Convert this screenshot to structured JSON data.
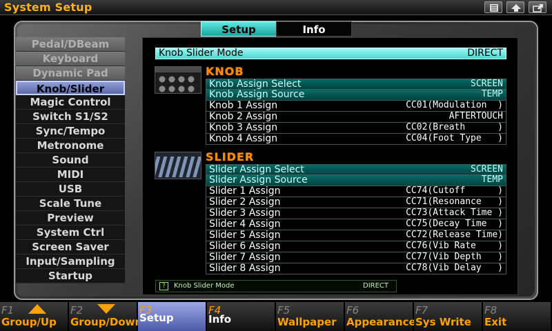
{
  "title": "System Setup",
  "title_buttons": [
    "list-icon",
    "up-arrow-icon",
    "export-icon"
  ],
  "tabs": [
    {
      "label": "Setup",
      "active": true
    },
    {
      "label": "Info",
      "active": false
    }
  ],
  "sidebar": {
    "items": [
      {
        "label": "Pedal/DBeam",
        "state": "dim"
      },
      {
        "label": "Keyboard",
        "state": "dim"
      },
      {
        "label": "Dynamic Pad",
        "state": "dim"
      },
      {
        "label": "Knob/Slider",
        "state": "active"
      },
      {
        "label": "Magic Control",
        "state": "normal"
      },
      {
        "label": "Switch S1/S2",
        "state": "normal"
      },
      {
        "label": "Sync/Tempo",
        "state": "normal"
      },
      {
        "label": "Metronome",
        "state": "normal"
      },
      {
        "label": "Sound",
        "state": "normal"
      },
      {
        "label": "MIDI",
        "state": "normal"
      },
      {
        "label": "USB",
        "state": "normal"
      },
      {
        "label": "Scale Tune",
        "state": "normal"
      },
      {
        "label": "Preview",
        "state": "normal"
      },
      {
        "label": "System Ctrl",
        "state": "normal"
      },
      {
        "label": "Screen Saver",
        "state": "normal"
      },
      {
        "label": "Input/Sampling",
        "state": "normal"
      },
      {
        "label": "Startup",
        "state": "normal"
      }
    ]
  },
  "mode": {
    "label": "Knob Slider Mode",
    "value": "DIRECT"
  },
  "knob": {
    "title": "KNOB",
    "rows": [
      {
        "label": "Knob Assign Select",
        "value": "SCREEN",
        "hl": true
      },
      {
        "label": "Knob Assign Source",
        "value": "TEMP",
        "hl": true
      },
      {
        "label": "Knob 1 Assign",
        "value": "CC01(Modulation  )",
        "hl": false
      },
      {
        "label": "Knob 2 Assign",
        "value": "AFTERTOUCH",
        "hl": false
      },
      {
        "label": "Knob 3 Assign",
        "value": "CC02(Breath      )",
        "hl": false
      },
      {
        "label": "Knob 4 Assign",
        "value": "CC04(Foot Type   )",
        "hl": false
      }
    ]
  },
  "slider": {
    "title": "SLIDER",
    "rows": [
      {
        "label": "Slider Assign Select",
        "value": "SCREEN",
        "hl": true
      },
      {
        "label": "Slider Assign Source",
        "value": "TEMP",
        "hl": true
      },
      {
        "label": "Slider 1 Assign",
        "value": "CC74(Cutoff      )",
        "hl": false
      },
      {
        "label": "Slider 2 Assign",
        "value": "CC71(Resonance   )",
        "hl": false
      },
      {
        "label": "Slider 3 Assign",
        "value": "CC73(Attack Time )",
        "hl": false
      },
      {
        "label": "Slider 4 Assign",
        "value": "CC75(Decay Time  )",
        "hl": false
      },
      {
        "label": "Slider 5 Assign",
        "value": "CC72(Release Time)",
        "hl": false
      },
      {
        "label": "Slider 6 Assign",
        "value": "CC76(Vib Rate    )",
        "hl": false
      },
      {
        "label": "Slider 7 Assign",
        "value": "CC77(Vib Depth   )",
        "hl": false
      },
      {
        "label": "Slider 8 Assign",
        "value": "CC78(Vib Delay   )",
        "hl": false
      }
    ]
  },
  "help": {
    "icon": "?",
    "label": "Knob Slider Mode",
    "value": "DIRECT"
  },
  "fkeys": [
    {
      "num": "F1",
      "label": "Group/Up",
      "icon": "up-triangle-icon",
      "state": "normal"
    },
    {
      "num": "F2",
      "label": "Group/Down",
      "icon": "down-triangle-icon",
      "state": "normal"
    },
    {
      "num": "F3",
      "label": "Setup",
      "state": "active"
    },
    {
      "num": "F4",
      "label": "Info",
      "state": "dimkey"
    },
    {
      "num": "F5",
      "label": "Wallpaper",
      "state": "normal"
    },
    {
      "num": "F6",
      "label": "Appearance",
      "state": "normal"
    },
    {
      "num": "F7",
      "label": "Sys Write",
      "state": "normal"
    },
    {
      "num": "F8",
      "label": "Exit",
      "state": "normal"
    }
  ],
  "colors": {
    "accent_orange": "#ffa200",
    "tab_cyan": "#4bd6cf",
    "active_blue": "#5b6aa8"
  }
}
